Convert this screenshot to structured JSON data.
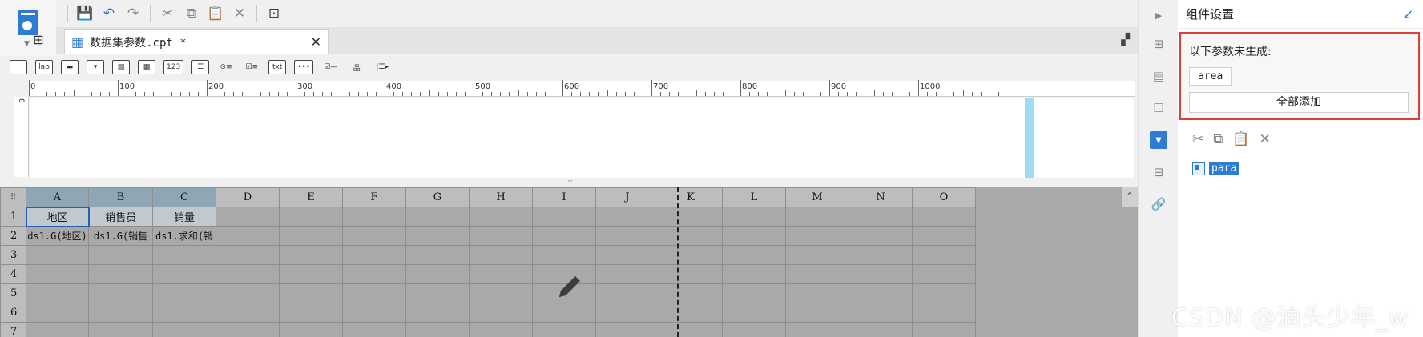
{
  "toolbar": {
    "save": "save-icon",
    "undo": "undo-icon",
    "redo": "redo-icon",
    "cut": "cut-icon",
    "copy": "copy-icon",
    "paste": "paste-icon",
    "delete": "delete-icon",
    "preview": "preview-icon"
  },
  "tab": {
    "title": "数据集参数.cpt *"
  },
  "ruler": {
    "labels": [
      "0",
      "100",
      "200",
      "300",
      "400",
      "500",
      "600",
      "700",
      "800",
      "900",
      "1000"
    ],
    "left_label": "0"
  },
  "widgets": [
    "text-widget",
    "label-widget",
    "button-widget",
    "dropdown-widget",
    "date-widget",
    "calendar-widget",
    "number-widget",
    "list-widget",
    "radio-group-widget",
    "checkbox-group-widget",
    "txt-widget",
    "password-widget",
    "checkbox-widget",
    "tree-widget",
    "query-widget"
  ],
  "widget_labels": {
    "label": "lab",
    "number": "123",
    "txt": "txt"
  },
  "sheet": {
    "columns": [
      "A",
      "B",
      "C",
      "D",
      "E",
      "F",
      "G",
      "H",
      "I",
      "J",
      "K",
      "L",
      "M",
      "N",
      "O"
    ],
    "rows": [
      "1",
      "2",
      "3",
      "4",
      "5",
      "6",
      "7"
    ],
    "row1": [
      "地区",
      "销售员",
      "销量"
    ],
    "row2": [
      "ds1.G(地区)",
      "ds1.G(销售",
      "ds1.求和(销"
    ]
  },
  "panel": {
    "title": "组件设置",
    "warning": "以下参数未生成:",
    "param": "area",
    "add_all": "全部添加",
    "tree_item": "para"
  },
  "watermark": "CSDN @油头少年_w"
}
